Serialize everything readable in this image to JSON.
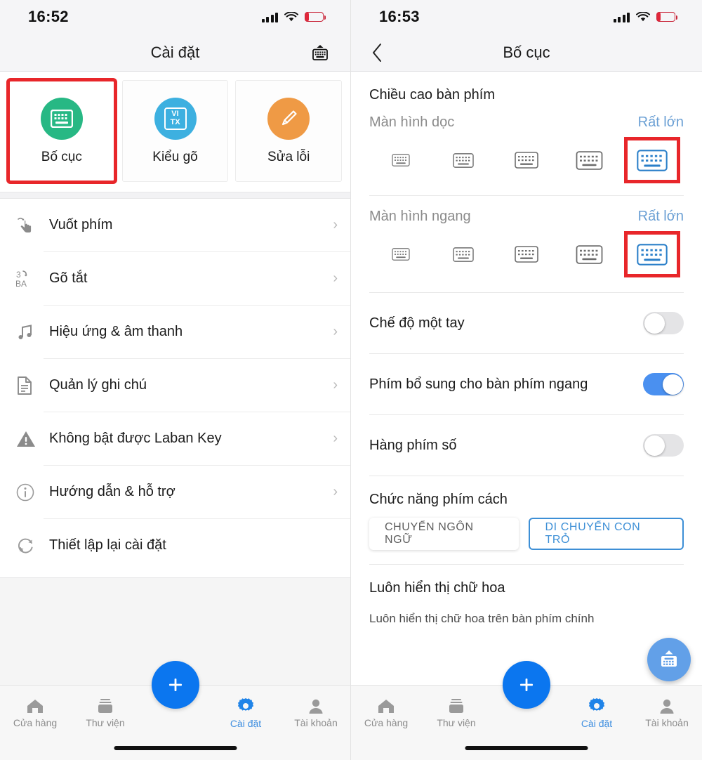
{
  "left": {
    "status": {
      "time": "16:52"
    },
    "nav": {
      "title": "Cài đặt",
      "right_icon": "keyboard-up-icon"
    },
    "cards": [
      {
        "label": "Bố cục",
        "icon": "keyboard-icon",
        "color": "#27b884",
        "highlighted": true
      },
      {
        "label": "Kiểu gõ",
        "icon": "vi-tx-icon",
        "color": "#3db0e0",
        "top": "VI",
        "bottom": "TX",
        "highlighted": false
      },
      {
        "label": "Sửa lỗi",
        "icon": "pencil-icon",
        "color": "#ef9a45",
        "highlighted": false
      }
    ],
    "menu": [
      {
        "label": "Vuốt phím",
        "icon": "swipe-hand-icon"
      },
      {
        "label": "Gõ tắt",
        "icon": "shortcut-3ba-icon"
      },
      {
        "label": "Hiệu ứng & âm thanh",
        "icon": "music-note-icon"
      },
      {
        "label": "Quản lý ghi chú",
        "icon": "document-icon"
      },
      {
        "label": "Không bật được Laban Key",
        "icon": "warning-icon"
      },
      {
        "label": "Hướng dẫn & hỗ trợ",
        "icon": "info-icon"
      },
      {
        "label": "Thiết lập lại cài đặt",
        "icon": "reset-refresh-icon"
      }
    ],
    "tabs": [
      {
        "label": "Cửa hàng",
        "icon": "home-icon",
        "active": false
      },
      {
        "label": "Thư viện",
        "icon": "library-icon",
        "active": false
      },
      {
        "label": "Cài đặt",
        "icon": "gear-icon",
        "active": true
      },
      {
        "label": "Tài khoản",
        "icon": "person-icon",
        "active": false
      }
    ],
    "fab": {
      "icon": "plus-icon"
    }
  },
  "right": {
    "status": {
      "time": "16:53"
    },
    "nav": {
      "title": "Bố cục",
      "back_icon": "chevron-left-icon"
    },
    "section_title": "Chiều cao bàn phím",
    "height_groups": [
      {
        "label": "Màn hình dọc",
        "value": "Rất lớn",
        "selected_index": 4,
        "options": 5
      },
      {
        "label": "Màn hình ngang",
        "value": "Rất lớn",
        "selected_index": 4,
        "options": 5
      }
    ],
    "toggles": [
      {
        "label": "Chế độ một tay",
        "on": false
      },
      {
        "label": "Phím bổ sung cho bàn phím ngang",
        "on": true
      },
      {
        "label": "Hàng phím số",
        "on": false
      }
    ],
    "spacekey": {
      "title": "Chức năng phím cách",
      "options": [
        {
          "label": "CHUYỂN NGÔN NGỮ",
          "active": false
        },
        {
          "label": "DI CHUYỂN CON TRỎ",
          "active": true
        }
      ]
    },
    "uppercase": {
      "title": "Luôn hiển thị chữ hoa",
      "subtitle": "Luôn hiển thị chữ hoa trên bàn phím chính"
    },
    "fab_keyboard": {
      "icon": "keyboard-up-icon"
    },
    "tabs": [
      {
        "label": "Cửa hàng",
        "icon": "home-icon",
        "active": false
      },
      {
        "label": "Thư viện",
        "icon": "library-icon",
        "active": false
      },
      {
        "label": "Cài đặt",
        "icon": "gear-icon",
        "active": true
      },
      {
        "label": "Tài khoản",
        "icon": "person-icon",
        "active": false
      }
    ],
    "fab": {
      "icon": "plus-icon"
    }
  },
  "colors": {
    "accent_blue": "#0b76ef",
    "toggle_on": "#4a90f0",
    "highlight_red": "#e8262a",
    "value_blue": "#6a9fd4",
    "chip_blue": "#3d8fd6"
  }
}
